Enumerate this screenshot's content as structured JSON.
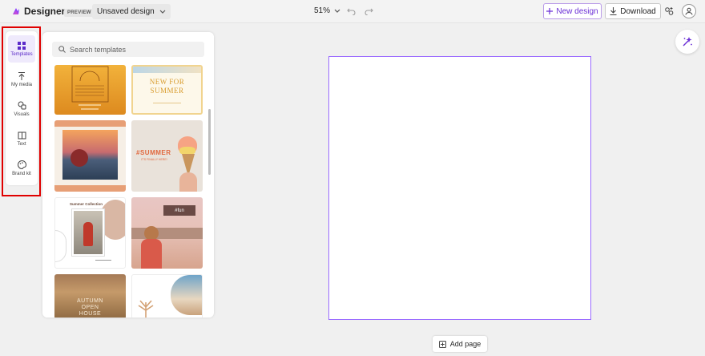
{
  "topbar": {
    "app_name": "Designer",
    "preview_badge": "PREVIEW",
    "design_name": "Unsaved design",
    "zoom": "51%",
    "new_design_label": "New design",
    "download_label": "Download"
  },
  "rail": {
    "items": [
      {
        "label": "Templates",
        "icon": "templates-icon",
        "active": true
      },
      {
        "label": "My media",
        "icon": "upload-icon"
      },
      {
        "label": "Visuals",
        "icon": "shapes-icon"
      },
      {
        "label": "Text",
        "icon": "text-icon"
      },
      {
        "label": "Brand kit",
        "icon": "palette-icon"
      }
    ]
  },
  "panel": {
    "search_placeholder": "Search templates",
    "templates": [
      {
        "text": ""
      },
      {
        "text": "NEW FOR SUMMER"
      },
      {
        "text": ""
      },
      {
        "text": "#SUMMER",
        "subtext": "IT'S FINALLY HERE!"
      },
      {
        "text": "Summer Collection"
      },
      {
        "text": "#fun"
      },
      {
        "text": "AUTUMN OPEN HOUSE"
      },
      {
        "text": ""
      }
    ]
  },
  "canvas": {
    "add_page_label": "Add page"
  },
  "colors": {
    "accent": "#6b2fd6",
    "canvas_border": "#9a6bff",
    "highlight": "#e00000"
  }
}
